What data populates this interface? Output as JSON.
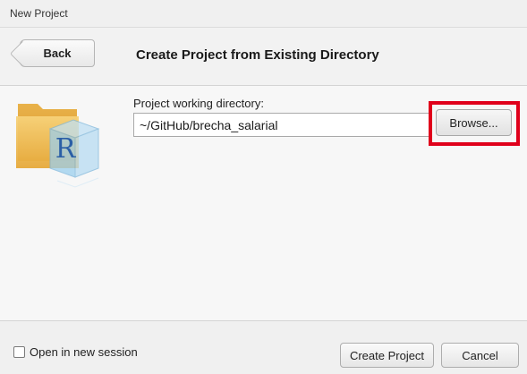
{
  "window": {
    "title": "New Project"
  },
  "header": {
    "back_label": "Back",
    "page_title": "Create Project from Existing Directory"
  },
  "form": {
    "directory_label": "Project working directory:",
    "directory_value": "~/GitHub/brecha_salarial",
    "browse_label": "Browse..."
  },
  "icon": {
    "name": "r-project-folder-icon",
    "glyph": "R",
    "folder_color": "#f2c14e",
    "cube_color": "#8cc3e8"
  },
  "highlight": {
    "color": "#e0001b"
  },
  "footer": {
    "open_new_session_label": "Open in new session",
    "open_new_session_checked": false,
    "create_label": "Create Project",
    "cancel_label": "Cancel"
  }
}
